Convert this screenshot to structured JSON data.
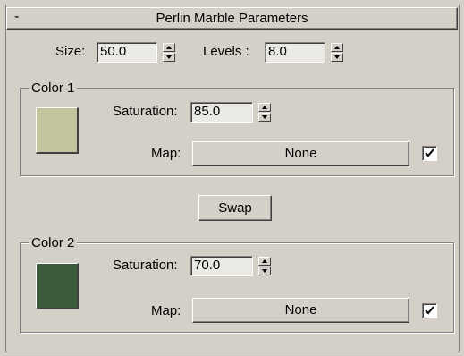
{
  "rollout": {
    "toggle": "-",
    "title": "Perlin Marble Parameters"
  },
  "size": {
    "label": "Size:",
    "value": "50.0"
  },
  "levels": {
    "label": "Levels :",
    "value": "8.0"
  },
  "color1": {
    "group_label": "Color 1",
    "swatch_color": "#c3c39d",
    "saturation_label": "Saturation:",
    "saturation_value": "85.0",
    "map_label": "Map:",
    "map_button": "None",
    "map_enabled": true
  },
  "swap_button": "Swap",
  "color2": {
    "group_label": "Color 2",
    "swatch_color": "#3b5b3c",
    "saturation_label": "Saturation:",
    "saturation_value": "70.0",
    "map_label": "Map:",
    "map_button": "None",
    "map_enabled": true
  },
  "icons": {
    "spinner": "spinner-up-down-arrows",
    "checkbox": "checkmark-icon"
  }
}
